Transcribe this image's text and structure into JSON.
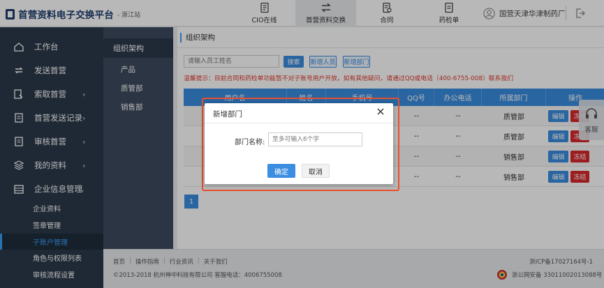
{
  "header": {
    "logo_text": "首营资料电子交换平台",
    "logo_sub": "- 浙江站",
    "tabs": [
      {
        "label": "CIO在线",
        "icon": "document-icon"
      },
      {
        "label": "首营资料交换",
        "icon": "exchange-icon",
        "active": true
      },
      {
        "label": "合同",
        "icon": "contract-icon"
      },
      {
        "label": "药检单",
        "icon": "report-icon"
      }
    ],
    "user_name": "国营天津华津制药厂"
  },
  "sidebar": {
    "items": [
      {
        "label": "工作台",
        "icon": "home-icon",
        "arrow": ""
      },
      {
        "label": "发送首营",
        "icon": "sync-icon",
        "arrow": ""
      },
      {
        "label": "索取首营",
        "icon": "request-icon",
        "arrow": "›"
      },
      {
        "label": "首营发送记录",
        "icon": "record-icon",
        "arrow": "›"
      },
      {
        "label": "审核首营",
        "icon": "audit-icon",
        "arrow": "›"
      },
      {
        "label": "我的资料",
        "icon": "layers-icon",
        "arrow": "›"
      },
      {
        "label": "企业信息管理",
        "icon": "company-icon",
        "arrow": "⌄"
      }
    ],
    "sub_items": [
      {
        "label": "企业资料"
      },
      {
        "label": "签章管理"
      },
      {
        "label": "子账户管理",
        "active": true
      },
      {
        "label": "角色与权限列表"
      },
      {
        "label": "审核流程设置"
      }
    ]
  },
  "sidebar2": {
    "items": [
      {
        "label": "组织架构",
        "active": true
      },
      {
        "label": "产品"
      },
      {
        "label": "质管部"
      },
      {
        "label": "销售部"
      }
    ]
  },
  "main": {
    "title": "组织架构",
    "search_placeholder": "请输入员工姓名",
    "search_button": "搜索",
    "add_member_button": "新增人员",
    "add_dept_button": "新增部门",
    "notice": "温馨提示：目前合同和药检单功能暂不对子账号用户开放，如有其他疑问，请通过QQ或电话（400-6755-008）联系我们",
    "columns": [
      "用户名",
      "姓名",
      "手机号",
      "QQ号",
      "办公电话",
      "所属部门",
      "操作"
    ],
    "rows": [
      {
        "qq": "--",
        "tel": "--",
        "dept": "质管部"
      },
      {
        "qq": "--",
        "tel": "--",
        "dept": "质管部"
      },
      {
        "qq": "--",
        "tel": "--",
        "dept": "销售部"
      },
      {
        "qq": "--",
        "tel": "--",
        "dept": "销售部"
      }
    ],
    "edit_label": "编辑",
    "freeze_label": "冻结",
    "page": "1"
  },
  "modal": {
    "title": "新增部门",
    "label": "部门名称:",
    "placeholder": "至多可输入6个字",
    "ok": "确定",
    "cancel": "取消"
  },
  "footer": {
    "links": [
      "首页",
      "操作指南",
      "行业资讯",
      "关于我们"
    ],
    "copyright": "©2013-2018   杭州神中科技有限公司   客服电话：4006755008",
    "icp": "浙ICP备17027164号-1",
    "police": "浙公网安备 33011002013088号"
  },
  "float_service": {
    "label": "客服"
  },
  "colors": {
    "primary": "#3a8de0",
    "danger": "#d9292c",
    "sidebar": "#2b3a4a",
    "highlight": "#e94e2b"
  }
}
